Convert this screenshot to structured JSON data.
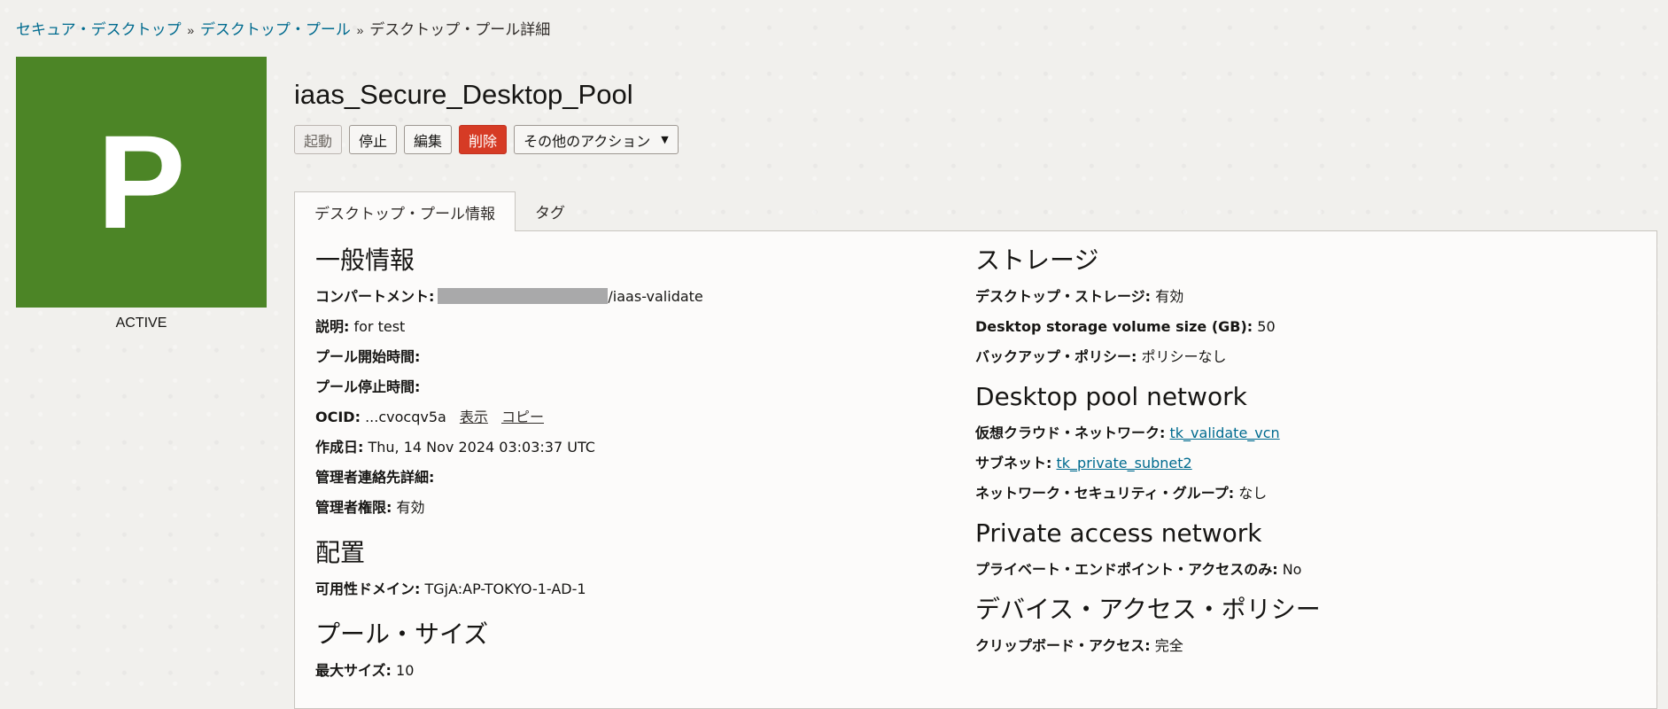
{
  "breadcrumb": {
    "item1": "セキュア・デスクトップ",
    "item2": "デスクトップ・プール",
    "current": "デスクトップ・プール詳細",
    "sep": "»"
  },
  "avatar": {
    "letter": "P",
    "status": "ACTIVE",
    "color": "#4c8526"
  },
  "title": "iaas_Secure_Desktop_Pool",
  "actions": {
    "start": "起動",
    "stop": "停止",
    "edit": "編集",
    "delete": "削除",
    "more": "その他のアクション",
    "caret": "▼"
  },
  "tabs": {
    "info": "デスクトップ・プール情報",
    "tags": "タグ"
  },
  "general": {
    "title": "一般情報",
    "compartment_label": "コンパートメント:",
    "compartment_value": "/iaas-validate",
    "description_label": "説明:",
    "description_value": "for test",
    "pool_start_label": "プール開始時間:",
    "pool_stop_label": "プール停止時間:",
    "ocid_label": "OCID:",
    "ocid_value": "...cvocqv5a",
    "ocid_show": "表示",
    "ocid_copy": "コピー",
    "created_label": "作成日:",
    "created_value": "Thu, 14 Nov 2024 03:03:37 UTC",
    "admin_contact_label": "管理者連絡先詳細:",
    "admin_rights_label": "管理者権限:",
    "admin_rights_value": "有効"
  },
  "placement": {
    "title": "配置",
    "ad_label": "可用性ドメイン:",
    "ad_value": "TGjA:AP-TOKYO-1-AD-1"
  },
  "pool_size": {
    "title": "プール・サイズ",
    "max_label": "最大サイズ:",
    "max_value": "10"
  },
  "storage": {
    "title": "ストレージ",
    "desktop_storage_label": "デスクトップ・ストレージ:",
    "desktop_storage_value": "有効",
    "volume_size_label": "Desktop storage volume size (GB):",
    "volume_size_value": "50",
    "backup_label": "バックアップ・ポリシー:",
    "backup_value": "ポリシーなし"
  },
  "network": {
    "title": "Desktop pool network",
    "vcn_label": "仮想クラウド・ネットワーク:",
    "vcn_value": "tk_validate_vcn",
    "subnet_label": "サブネット:",
    "subnet_value": "tk_private_subnet2",
    "nsg_label": "ネットワーク・セキュリティ・グループ:",
    "nsg_value": "なし"
  },
  "private_access": {
    "title": "Private access network",
    "endpoint_label": "プライベート・エンドポイント・アクセスのみ:",
    "endpoint_value": "No"
  },
  "device_policy": {
    "title": "デバイス・アクセス・ポリシー",
    "clipboard_label": "クリップボード・アクセス:",
    "clipboard_value": "完全"
  }
}
